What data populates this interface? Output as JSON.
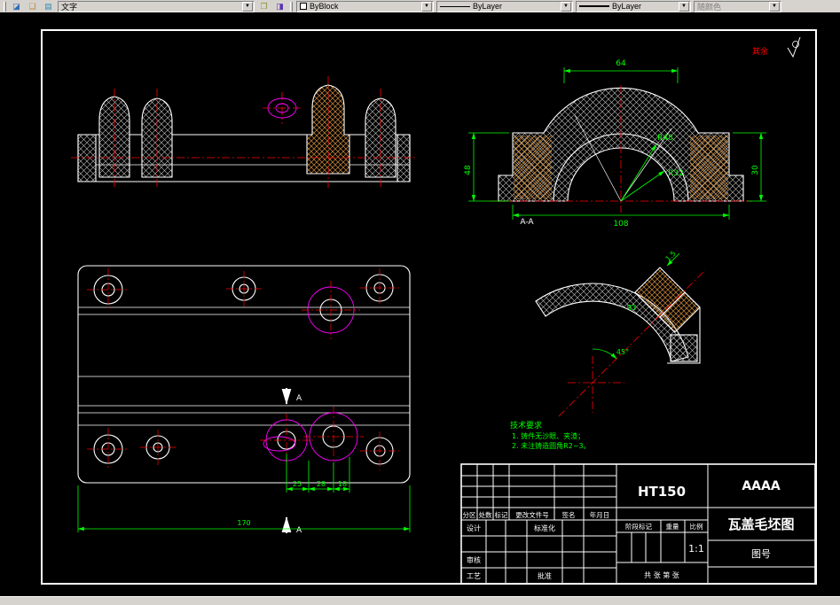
{
  "toolbar": {
    "text_style_value": "文字",
    "color_value": "ByBlock",
    "linetype_value": "ByLayer",
    "lineweight_value": "ByLayer",
    "plot_style_value": "随颜色",
    "dropdown_glyph": "▼"
  },
  "colors": {
    "background": "#000000",
    "outline": "#ffffff",
    "dimension": "#00ff00",
    "centerline": "#ff0000",
    "phantom": "#ff00ff",
    "hatch_accent": "#cf8b3a",
    "toolbar_bg": "#d6d3ce"
  },
  "drawing": {
    "surface_note": "其余",
    "section_view_label": "A-A",
    "section_cut_label": "A",
    "tech_req_title": "技术要求",
    "tech_req_1": "1. 铸件无沙眼、夹渣；",
    "tech_req_2": "2. 未注铸造圆角R2~3。"
  },
  "dims": {
    "arch_w_top": "64",
    "arch_w_bottom": "108",
    "arch_h_left": "48",
    "arch_h_right": "30",
    "arch_r1": "R32",
    "arch_r2": "R48",
    "plan_overall": "170",
    "plan_a": "25",
    "plan_b": "28",
    "plan_c": "18",
    "detail_t": "1.5",
    "detail_r": "R3",
    "detail_angle": "45°"
  },
  "title_block": {
    "material": "HT150",
    "company": "AAAA",
    "drawing_title": "瓦盖毛坯图",
    "drawing_no_label": "图号",
    "scale_value": "1:1",
    "rev_headers": [
      "分区",
      "处数",
      "标记",
      "更改文件号",
      "签名",
      "年月日"
    ],
    "design_label": "设计",
    "standard_label": "标准化",
    "audit_label": "审核",
    "process_label": "工艺",
    "approve_label": "批准",
    "stage_label": "阶段标记",
    "weight_label": "重量",
    "scale_label": "比例",
    "sheet_label": "共 张 第 张"
  }
}
